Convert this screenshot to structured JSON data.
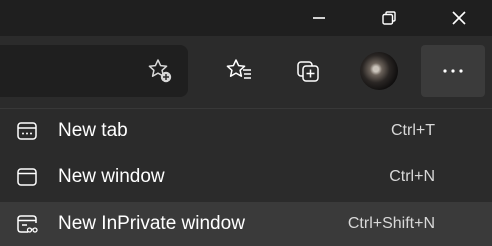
{
  "window_controls": {
    "minimize": "minimize-icon",
    "restore": "restore-icon",
    "close": "close-icon"
  },
  "toolbar": {
    "add_favorite_icon": "star-plus-icon",
    "favorites_icon": "favorites-list-icon",
    "collections_icon": "collections-icon",
    "profile": "avatar",
    "menu_icon": "more-horizontal-icon"
  },
  "menu": {
    "items": [
      {
        "label": "New tab",
        "shortcut": "Ctrl+T",
        "icon": "new-tab-icon"
      },
      {
        "label": "New window",
        "shortcut": "Ctrl+N",
        "icon": "new-window-icon"
      },
      {
        "label": "New InPrivate window",
        "shortcut": "Ctrl+Shift+N",
        "icon": "inprivate-icon"
      }
    ]
  },
  "colors": {
    "background": "#1f1f1f",
    "toolbar": "#2b2b2b",
    "menu": "#2b2b2b",
    "hover": "#3a3a3a",
    "text": "#ffffff"
  }
}
